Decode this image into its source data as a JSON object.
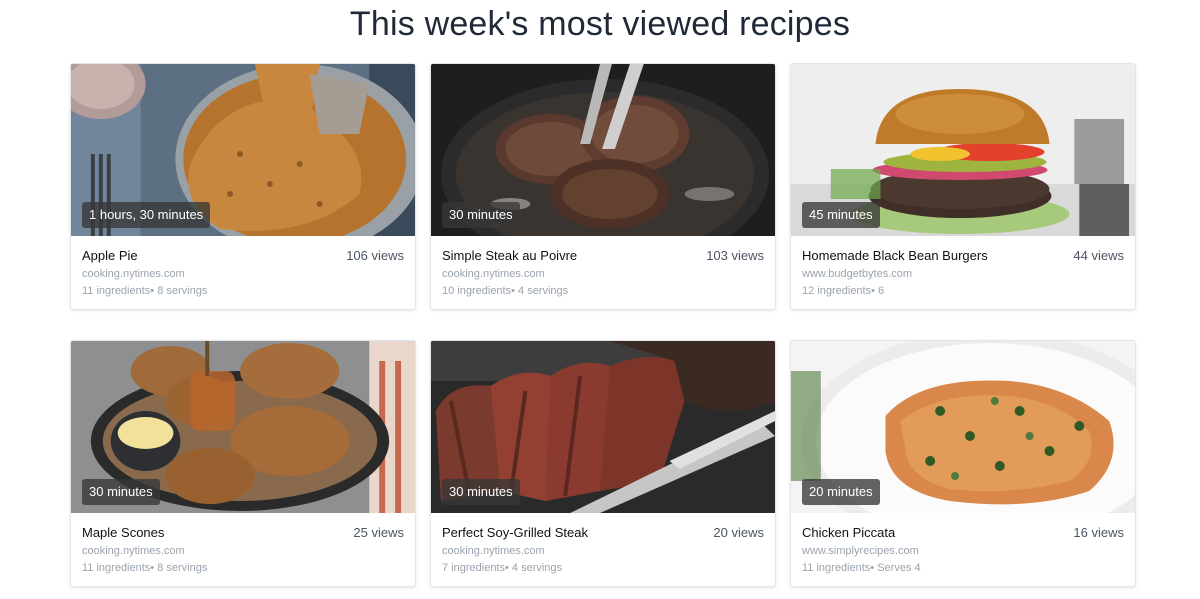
{
  "page": {
    "title": "This week's most viewed recipes"
  },
  "recipes": [
    {
      "title": "Apple Pie",
      "views": "106 views",
      "source": "cooking.nytimes.com",
      "ingredients": "11 ingredients",
      "servings": "• 8 servings",
      "time": "1 hours, 30 minutes",
      "image": "apple-pie-photo"
    },
    {
      "title": "Simple Steak au Poivre",
      "views": "103 views",
      "source": "cooking.nytimes.com",
      "ingredients": "10 ingredients",
      "servings": "• 4 servings",
      "time": "30 minutes",
      "image": "steak-au-poivre-photo"
    },
    {
      "title": "Homemade Black Bean Burgers",
      "views": "44 views",
      "source": "www.budgetbytes.com",
      "ingredients": "12 ingredients",
      "servings": "• 6",
      "time": "45 minutes",
      "image": "black-bean-burger-photo"
    },
    {
      "title": "Maple Scones",
      "views": "25 views",
      "source": "cooking.nytimes.com",
      "ingredients": "11 ingredients",
      "servings": "• 8 servings",
      "time": "30 minutes",
      "image": "maple-scones-photo"
    },
    {
      "title": "Perfect Soy-Grilled Steak",
      "views": "20 views",
      "source": "cooking.nytimes.com",
      "ingredients": "7 ingredients",
      "servings": "• 4 servings",
      "time": "30 minutes",
      "image": "grilled-steak-photo"
    },
    {
      "title": "Chicken Piccata",
      "views": "16 views",
      "source": "www.simplyrecipes.com",
      "ingredients": "11 ingredients",
      "servings": "• Serves 4",
      "time": "20 minutes",
      "image": "chicken-piccata-photo"
    }
  ]
}
